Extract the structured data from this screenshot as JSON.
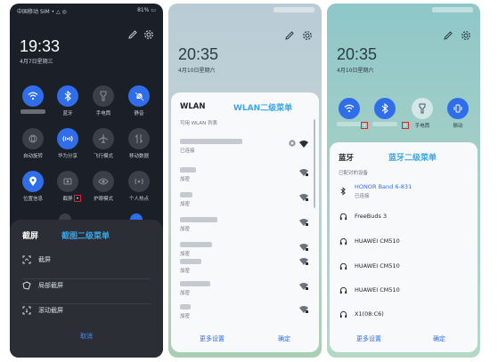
{
  "panel1": {
    "status": {
      "left": "中国移动 SIM • △ ◎",
      "right": "81% ▭"
    },
    "time": "19:33",
    "date": "4月7日星期三",
    "tiles": [
      {
        "label": "",
        "icon": "wifi-icon",
        "active": true
      },
      {
        "label": "蓝牙",
        "icon": "bluetooth-icon",
        "active": true
      },
      {
        "label": "手电筒",
        "icon": "flashlight-icon",
        "active": false
      },
      {
        "label": "静音",
        "icon": "mute-icon",
        "active": true
      },
      {
        "label": "自动旋转",
        "icon": "rotate-icon",
        "active": false
      },
      {
        "label": "华为分享",
        "icon": "share-icon",
        "active": true
      },
      {
        "label": "飞行模式",
        "icon": "airplane-icon",
        "active": false
      },
      {
        "label": "移动数据",
        "icon": "data-icon",
        "active": false
      },
      {
        "label": "位置信息",
        "icon": "location-icon",
        "active": true
      },
      {
        "label": "截屏",
        "icon": "screenshot-icon",
        "active": false
      },
      {
        "label": "护眼模式",
        "icon": "eye-icon",
        "active": false
      },
      {
        "label": "个人热点",
        "icon": "hotspot-icon",
        "active": false
      }
    ],
    "sheet_title": "截屏",
    "menu_tag": "截图二级菜单",
    "options": [
      {
        "label": "截屏",
        "icon": "screenshot-icon"
      },
      {
        "label": "局部截屏",
        "icon": "partial-screenshot-icon"
      },
      {
        "label": "滚动截屏",
        "icon": "scroll-screenshot-icon"
      }
    ],
    "cancel": "取消"
  },
  "panel2": {
    "time": "20:35",
    "date": "4月10日星期六",
    "card_title": "WLAN",
    "menu_tag": "WLAN二级菜单",
    "list_header": "可用 WLAN 列表",
    "networks": [
      {
        "status": "已连接"
      },
      {
        "status": "加密"
      },
      {
        "status": "加密"
      },
      {
        "status": "加密"
      },
      {
        "status": "加密"
      },
      {
        "status": "加密"
      },
      {
        "status": "加密"
      },
      {
        "status": "加密"
      }
    ],
    "more_settings": "更多设置",
    "confirm": "确定"
  },
  "panel3": {
    "time": "20:35",
    "date": "4月10日星期六",
    "tiles": [
      {
        "label": "",
        "icon": "wifi-icon"
      },
      {
        "label": "",
        "icon": "bluetooth-icon"
      },
      {
        "label": "手电筒",
        "icon": "flashlight-icon"
      },
      {
        "label": "振动",
        "icon": "vibrate-icon"
      }
    ],
    "card_title": "蓝牙",
    "menu_tag": "蓝牙二级菜单",
    "list_header": "已配对的设备",
    "devices": [
      {
        "name": "HONOR Band 6-831",
        "status": "已连接",
        "icon": "bluetooth-icon"
      },
      {
        "name": "FreeBuds 3",
        "status": "",
        "icon": "headphones-icon"
      },
      {
        "name": "HUAWEI CM510",
        "status": "",
        "icon": "headphones-icon"
      },
      {
        "name": "HUAWEI CM510",
        "status": "",
        "icon": "headphones-icon"
      },
      {
        "name": "HUAWEI CM510",
        "status": "",
        "icon": "headphones-icon"
      },
      {
        "name": "X1(08:C6)",
        "status": "",
        "icon": "headphones-icon"
      }
    ],
    "more_settings": "更多设置",
    "confirm": "确定"
  },
  "colors": {
    "accent": "#2f6de9",
    "menu_tag": "#3aa6e6",
    "highlight_box": "#e0232b",
    "dark_bg": "#1b1f27"
  }
}
